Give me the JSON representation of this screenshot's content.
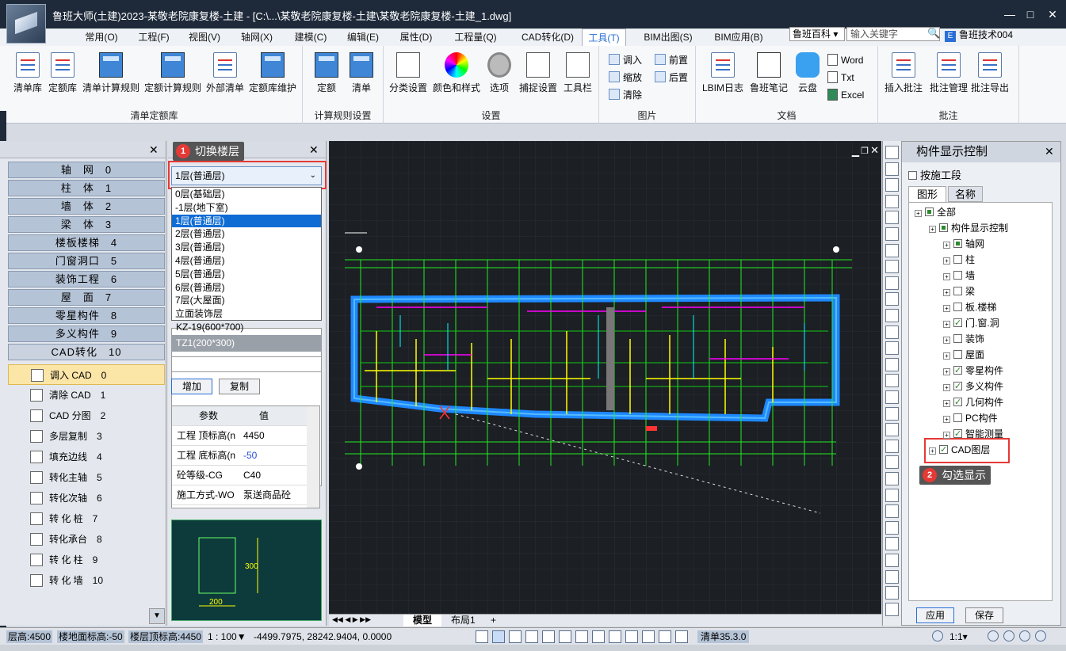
{
  "window": {
    "title": "鲁班大师(土建)2023-某敬老院康复楼-土建 - [C:\\...\\某敬老院康复楼-土建\\某敬老院康复楼-土建_1.dwg]",
    "min": "—",
    "max": "□",
    "close": "✕"
  },
  "menu": {
    "tabs": [
      "常用(O)",
      "工程(F)",
      "视图(V)",
      "轴网(X)",
      "建模(C)",
      "编辑(E)",
      "属性(D)",
      "工程量(Q)",
      "CAD转化(D)",
      "工具(T)",
      "BIM出图(S)",
      "BIM应用(B)"
    ],
    "active": "工具(T)",
    "help": "鲁班百科 ▾",
    "search_placeholder": "输入关键字",
    "user": "鲁班技术004"
  },
  "ribbon": {
    "g1": {
      "label": "清单定额库",
      "buttons": [
        "清单库",
        "定额库",
        "清单计算规则",
        "定额计算规则",
        "外部清单",
        "定额库维护"
      ]
    },
    "g2": {
      "label": "计算规则设置",
      "buttons": [
        "定额",
        "清单"
      ]
    },
    "g3": {
      "label": "设置",
      "buttons": [
        "分类设置",
        "颜色和样式",
        "选项",
        "捕捉设置",
        "工具栏"
      ]
    },
    "g4": {
      "label": "图片",
      "items": [
        "调入",
        "缩放",
        "清除",
        "前置",
        "后置"
      ]
    },
    "g5": {
      "label": "文档",
      "buttons": [
        "LBIM日志",
        "鲁班笔记",
        "云盘"
      ],
      "items": [
        "Word",
        "Txt",
        "Excel"
      ]
    },
    "g6": {
      "label": "批注",
      "buttons": [
        "插入批注",
        "批注管理",
        "批注导出"
      ]
    }
  },
  "left_panel": {
    "categories": [
      "轴　网　0",
      "柱　体　1",
      "墙　体　2",
      "梁　体　3",
      "楼板楼梯　4",
      "门窗洞口　5",
      "装饰工程　6",
      "屋　面　7",
      "零星构件　8",
      "多义构件　9",
      "CAD转化　10"
    ],
    "tools": [
      "调入 CAD　0",
      "清除 CAD　1",
      "CAD 分图　2",
      "多层复制　3",
      "填充边线　4",
      "转化主轴　5",
      "转化次轴　6",
      "转 化 桩　7",
      "转化承台　8",
      "转 化 柱　9",
      "转 化 墙　10"
    ],
    "selected_tool": 0
  },
  "floor_panel": {
    "callout_num": "1",
    "callout": "切换楼层",
    "selected": "1层(普通层)",
    "options": [
      "0层(基础层)",
      "-1层(地下室)",
      "1层(普通层)",
      "2层(普通层)",
      "3层(普通层)",
      "4层(普通层)",
      "5层(普通层)",
      "6层(普通层)",
      "7层(大屋面)",
      "立面装饰层"
    ],
    "selected_index": 2,
    "list": [
      "KZ-19(600*700)",
      "TZ1(200*300)"
    ],
    "add": "增加",
    "copy": "复制",
    "param_head": "参数",
    "value_head": "值",
    "params": [
      {
        "k": "工程 顶标高(n",
        "v": "4450"
      },
      {
        "k": "工程 底标高(n",
        "v": "-50"
      },
      {
        "k": "砼等级-CG",
        "v": "C40"
      },
      {
        "k": "施工方式-WO",
        "v": "泵送商品砼"
      }
    ],
    "preview": {
      "w": "200",
      "h": "300"
    }
  },
  "canvas": {
    "tabs": [
      "模型",
      "布局1",
      "+"
    ]
  },
  "right_panel": {
    "title": "构件显示控制",
    "by_stage": "按施工段",
    "tabs": [
      "图形",
      "名称"
    ],
    "tree": [
      {
        "t": "全部",
        "lvl": 0,
        "s": "part"
      },
      {
        "t": "构件显示控制",
        "lvl": 1,
        "s": "part"
      },
      {
        "t": "轴网",
        "lvl": 2,
        "s": "part"
      },
      {
        "t": "柱",
        "lvl": 2,
        "s": "off"
      },
      {
        "t": "墙",
        "lvl": 2,
        "s": "off"
      },
      {
        "t": "梁",
        "lvl": 2,
        "s": "off"
      },
      {
        "t": "板.楼梯",
        "lvl": 2,
        "s": "off"
      },
      {
        "t": "门.窗.洞",
        "lvl": 2,
        "s": "on"
      },
      {
        "t": "装饰",
        "lvl": 2,
        "s": "off"
      },
      {
        "t": "屋面",
        "lvl": 2,
        "s": "off"
      },
      {
        "t": "零星构件",
        "lvl": 2,
        "s": "on"
      },
      {
        "t": "多义构件",
        "lvl": 2,
        "s": "on"
      },
      {
        "t": "几何构件",
        "lvl": 2,
        "s": "on"
      },
      {
        "t": "PC构件",
        "lvl": 2,
        "s": "off"
      },
      {
        "t": "智能测量",
        "lvl": 2,
        "s": "on"
      },
      {
        "t": "CAD图层",
        "lvl": 1,
        "s": "on"
      }
    ],
    "callout_num": "2",
    "callout": "勾选显示",
    "apply": "应用",
    "save": "保存"
  },
  "status": {
    "floor_height": "层高:4500",
    "floor_elev": "楼地面标高:-50",
    "top_elev": "楼层顶标高:4450",
    "scale": "1 : 100▼",
    "coords": "-4499.7975, 28242.9404, 0.0000",
    "bill": "清单35.3.0",
    "scale2": "1:1▾"
  },
  "colors": {
    "accent": "#2a6fd6",
    "callout_red": "#e53935",
    "cad_bg": "#1c1f24"
  }
}
